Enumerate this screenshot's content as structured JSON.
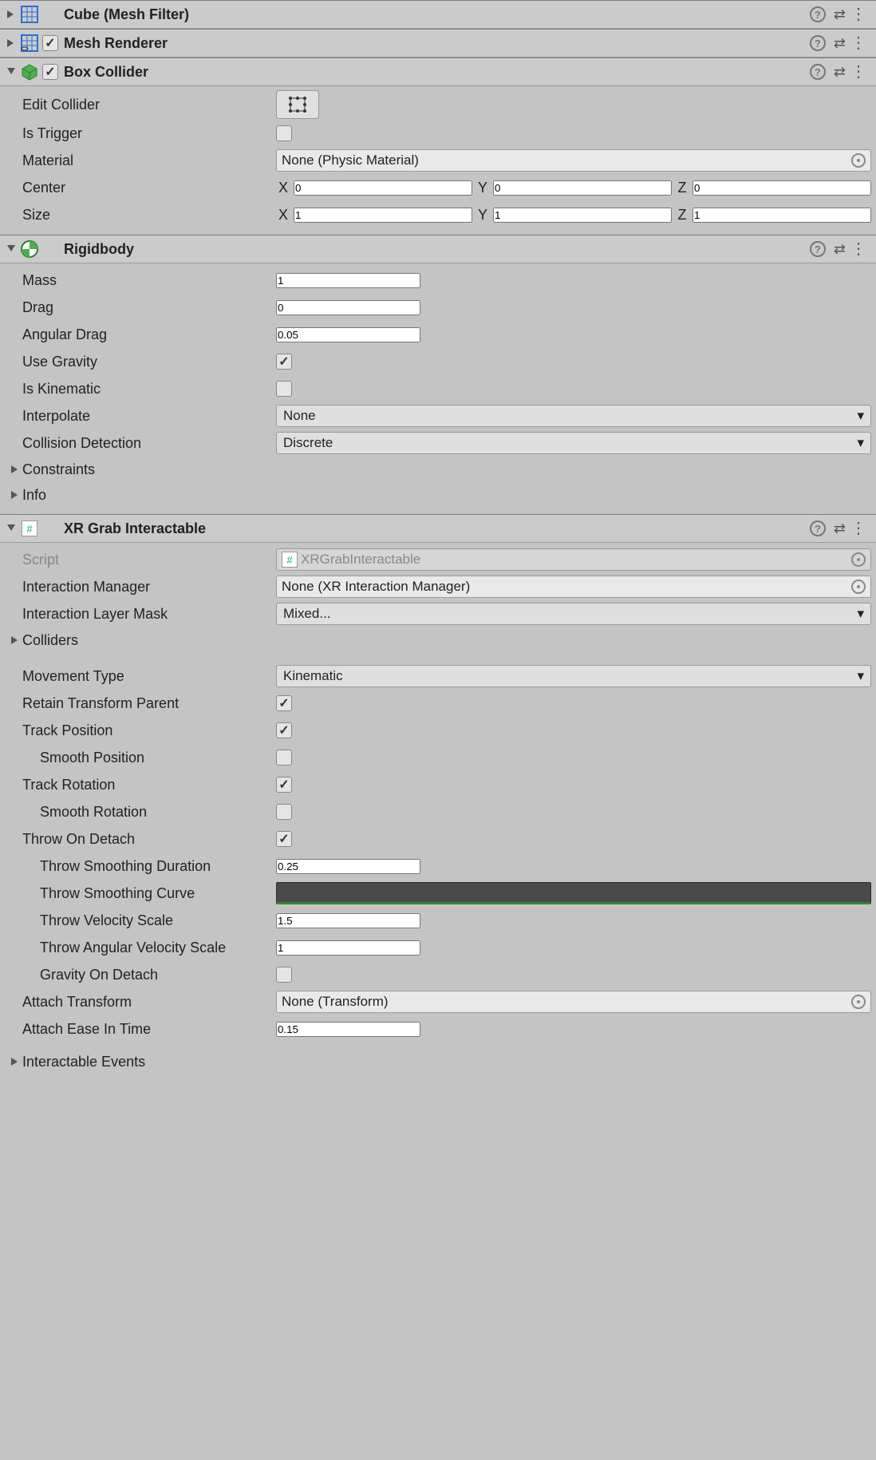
{
  "components": {
    "meshFilter": {
      "title": "Cube (Mesh Filter)"
    },
    "meshRenderer": {
      "title": "Mesh Renderer",
      "enabled": true
    },
    "boxCollider": {
      "title": "Box Collider",
      "enabled": true,
      "editCollider": "Edit Collider",
      "isTrigger": "Is Trigger",
      "material": "Material",
      "materialValue": "None (Physic Material)",
      "center": "Center",
      "centerX": "0",
      "centerY": "0",
      "centerZ": "0",
      "size": "Size",
      "sizeX": "1",
      "sizeY": "1",
      "sizeZ": "1",
      "X": "X",
      "Y": "Y",
      "Z": "Z"
    },
    "rigidbody": {
      "title": "Rigidbody",
      "mass": "Mass",
      "massV": "1",
      "drag": "Drag",
      "dragV": "0",
      "angularDrag": "Angular Drag",
      "angularDragV": "0.05",
      "useGravity": "Use Gravity",
      "isKinematic": "Is Kinematic",
      "interpolate": "Interpolate",
      "interpolateV": "None",
      "collisionDetection": "Collision Detection",
      "collisionDetectionV": "Discrete",
      "constraints": "Constraints",
      "info": "Info"
    },
    "xrGrab": {
      "title": "XR Grab Interactable",
      "script": "Script",
      "scriptV": "XRGrabInteractable",
      "interactionManager": "Interaction Manager",
      "interactionManagerV": "None (XR Interaction Manager)",
      "interactionLayerMask": "Interaction Layer Mask",
      "interactionLayerMaskV": "Mixed...",
      "colliders": "Colliders",
      "movementType": "Movement Type",
      "movementTypeV": "Kinematic",
      "retainTransformParent": "Retain Transform Parent",
      "trackPosition": "Track Position",
      "smoothPosition": "Smooth Position",
      "trackRotation": "Track Rotation",
      "smoothRotation": "Smooth Rotation",
      "throwOnDetach": "Throw On Detach",
      "throwSmoothingDuration": "Throw Smoothing Duration",
      "throwSmoothingDurationV": "0.25",
      "throwSmoothingCurve": "Throw Smoothing Curve",
      "throwVelocityScale": "Throw Velocity Scale",
      "throwVelocityScaleV": "1.5",
      "throwAngularVelocityScale": "Throw Angular Velocity Scale",
      "throwAngularVelocityScaleV": "1",
      "gravityOnDetach": "Gravity On Detach",
      "attachTransform": "Attach Transform",
      "attachTransformV": "None (Transform)",
      "attachEaseInTime": "Attach Ease In Time",
      "attachEaseInTimeV": "0.15",
      "interactableEvents": "Interactable Events"
    }
  }
}
